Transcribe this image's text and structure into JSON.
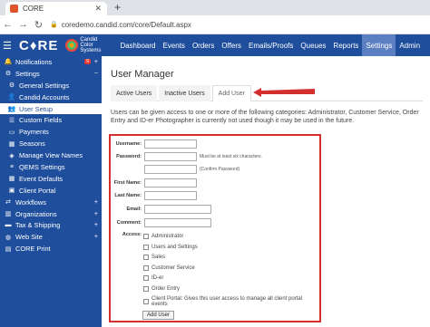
{
  "browser": {
    "tab_title": "CORE",
    "url": "coredemo.candid.com/core/Default.aspx"
  },
  "appnav": {
    "logo": "C♦RE",
    "brand": "Candid Color Systems",
    "items": [
      {
        "label": "Dashboard",
        "active": false
      },
      {
        "label": "Events",
        "active": false
      },
      {
        "label": "Orders",
        "active": false
      },
      {
        "label": "Offers",
        "active": false
      },
      {
        "label": "Emails/Proofs",
        "active": false
      },
      {
        "label": "Queues",
        "active": false
      },
      {
        "label": "Reports",
        "active": false
      },
      {
        "label": "Settings",
        "active": true
      },
      {
        "label": "Admin",
        "active": false
      }
    ]
  },
  "sidebar": {
    "items": [
      {
        "label": "Notifications",
        "icon": "bell-icon",
        "right": "+",
        "badge": "9",
        "sub": false,
        "selected": false
      },
      {
        "label": "Settings",
        "icon": "gear-icon",
        "right": "−",
        "sub": false,
        "selected": false
      },
      {
        "label": "General Settings",
        "icon": "cog-icon",
        "sub": true,
        "selected": false
      },
      {
        "label": "Candid Accounts",
        "icon": "user-icon",
        "sub": true,
        "selected": false
      },
      {
        "label": "User Setup",
        "icon": "users-icon",
        "sub": true,
        "selected": true
      },
      {
        "label": "Custom Fields",
        "icon": "list-icon",
        "sub": true,
        "selected": false
      },
      {
        "label": "Payments",
        "icon": "card-icon",
        "sub": true,
        "selected": false
      },
      {
        "label": "Seasons",
        "icon": "calendar-icon",
        "sub": true,
        "selected": false
      },
      {
        "label": "Manage View Names",
        "icon": "tag-icon",
        "sub": true,
        "selected": false
      },
      {
        "label": "QEMS Settings",
        "icon": "sliders-icon",
        "sub": true,
        "selected": false
      },
      {
        "label": "Event Defaults",
        "icon": "calendar-check-icon",
        "sub": true,
        "selected": false
      },
      {
        "label": "Client Portal",
        "icon": "portal-icon",
        "sub": true,
        "selected": false
      },
      {
        "label": "Workflows",
        "icon": "flow-icon",
        "right": "+",
        "sub": false,
        "selected": false
      },
      {
        "label": "Organizations",
        "icon": "building-icon",
        "right": "+",
        "sub": false,
        "selected": false
      },
      {
        "label": "Tax & Shipping",
        "icon": "truck-icon",
        "right": "+",
        "sub": false,
        "selected": false
      },
      {
        "label": "Web Site",
        "icon": "globe-icon",
        "right": "+",
        "sub": false,
        "selected": false
      },
      {
        "label": "CORE Print",
        "icon": "print-icon",
        "sub": false,
        "selected": false
      }
    ]
  },
  "main": {
    "title": "User Manager",
    "tabs": [
      {
        "label": "Active Users",
        "active": false
      },
      {
        "label": "Inactive Users",
        "active": false
      },
      {
        "label": "Add User",
        "active": true
      }
    ],
    "description": "Users can be given access to one or more of the following categories: Administrator, Customer Service, Order Entry and ID-er Photographer is currently not used though it may be used in the future.",
    "form": {
      "username_label": "Username:",
      "password_label": "Password:",
      "password_hint": "Must be at least six characters.",
      "confirm_hint": "(Confirm Password)",
      "first_name_label": "First Name:",
      "last_name_label": "Last Name:",
      "email_label": "Email:",
      "comment_label": "Comment:",
      "access_label": "Access:",
      "access_options": [
        "Administrator",
        "Users and Settings",
        "Sales",
        "Customer Service",
        "ID-er",
        "Order Entry",
        "Client Portal: Gives this user access to manage all client portal events"
      ],
      "submit_label": "Add User"
    }
  },
  "colors": {
    "nav_bg": "#1f4e9c",
    "annotation_red": "#d32f2f"
  }
}
